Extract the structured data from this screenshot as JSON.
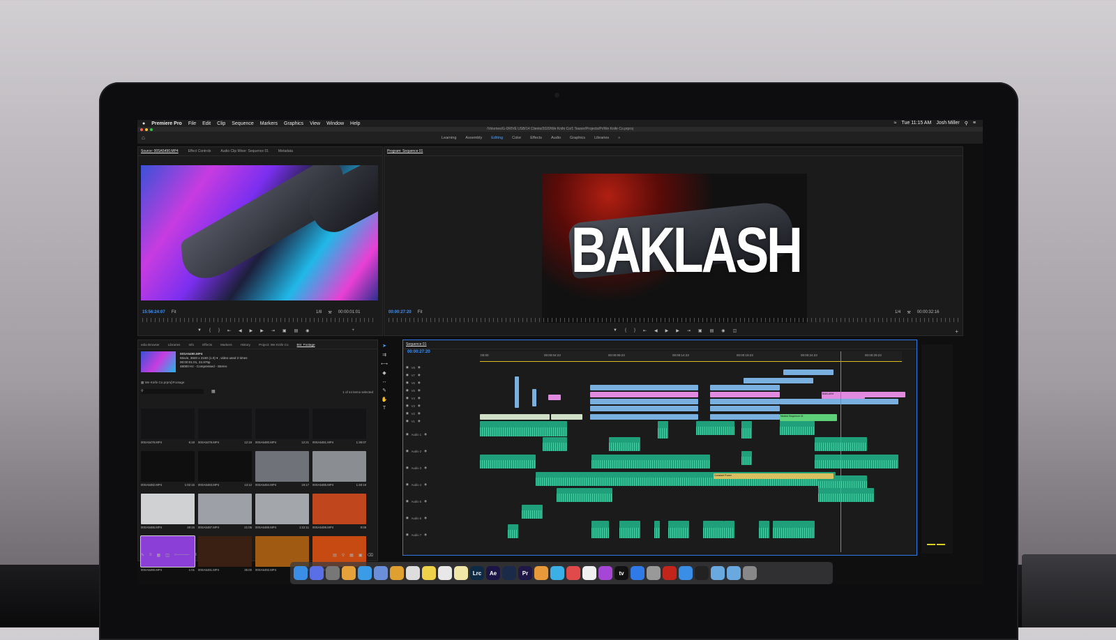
{
  "menubar": {
    "apple": "",
    "app": "Premiere Pro",
    "items": [
      "File",
      "Edit",
      "Clip",
      "Sequence",
      "Markers",
      "Graphics",
      "View",
      "Window",
      "Help"
    ],
    "clock": "Tue 11:15 AM",
    "user": "Josh Miller"
  },
  "titlebar": {
    "path": "/Volumes/G-DRIVE USB/14 Clients/2020/We Knife Co/1 Teaser/Projects/Pr/We Knife Co.prproj"
  },
  "workspaces": [
    "Learning",
    "Assembly",
    "Editing",
    "Color",
    "Effects",
    "Audio",
    "Graphics",
    "Libraries"
  ],
  "active_workspace": "Editing",
  "source": {
    "tabs": [
      "Source: 00SA5490.MP4",
      "Effect Controls",
      "Audio Clip Mixer: Sequence 01",
      "Metadata"
    ],
    "timecode": "15:56:24:07",
    "fit": "Fit",
    "resolution": "1/8",
    "duration": "00:00:01:01"
  },
  "program": {
    "tab": "Program: Sequence 01",
    "title_overlay": "BAKLASH",
    "timecode": "00:00:27:20",
    "fit": "Fit",
    "resolution": "1/4",
    "duration": "00:00:32:16"
  },
  "project": {
    "tabs": [
      "edia Browser",
      "Libraries",
      "Info",
      "Effects",
      "Markers",
      "History",
      "Project: We Knife Co",
      "Bin: Footage"
    ],
    "clip_name": "00SA5490.MP4",
    "clip_info": [
      "Movie, 3840 x 2160 (1.0) ▾ , video used 2 times",
      "00:00:01:01, 23.976p",
      "48000 Hz - Compressed - Stereo"
    ],
    "bin_path": "We Knife Co.prproj\\Footage",
    "selection": "1 of 44 items selected",
    "thumbs": [
      {
        "name": "00SA5478.MP4",
        "dur": "6:18",
        "tone": "#141416"
      },
      {
        "name": "00SA5479.MP4",
        "dur": "12:19",
        "tone": "#141416"
      },
      {
        "name": "00SA5480.MP4",
        "dur": "12:21",
        "tone": "#141416"
      },
      {
        "name": "00SA5481.MP4",
        "dur": "1:39:07",
        "tone": "#141416"
      },
      {
        "name": "00SA5482.MP4",
        "dur": "1:02:16",
        "tone": "#0f0f10"
      },
      {
        "name": "00SA5483.MP4",
        "dur": "13:12",
        "tone": "#0f0f10"
      },
      {
        "name": "00SA5484.MP4",
        "dur": "19:17",
        "tone": "#6f7379"
      },
      {
        "name": "00SA5485.MP4",
        "dur": "1:48:19",
        "tone": "#8a8e93"
      },
      {
        "name": "00SA5486.MP4",
        "dur": "49:15",
        "tone": "#cfd1d3"
      },
      {
        "name": "00SA5487.MP4",
        "dur": "21:05",
        "tone": "#9da0a6"
      },
      {
        "name": "00SA5488.MP4",
        "dur": "1:22:11",
        "tone": "#a3a6ab"
      },
      {
        "name": "00SA5489.MP4",
        "dur": "9:08",
        "tone": "#c0461d"
      },
      {
        "name": "00SA5490.MP4",
        "dur": "1:01",
        "tone": "#8b3fd6"
      },
      {
        "name": "00SA5491.MP4",
        "dur": "35:00",
        "tone": "#3a2012"
      },
      {
        "name": "00SA5492.MP4",
        "dur": "1:17:01",
        "tone": "#a15a12"
      },
      {
        "name": "00SA5493.MP4",
        "dur": "5:09",
        "tone": "#c64a12"
      }
    ]
  },
  "timeline": {
    "tab": "Sequence 01",
    "timecode": "00:00:27:20",
    "ruler": [
      ":00:00",
      "00:00:04:23",
      "00:00:09:23",
      "00:00:14:23",
      "00:00:19:23",
      "00:00:24:23",
      "00:00:29:23"
    ],
    "tracks_video": [
      "V8",
      "V7",
      "V6",
      "V5",
      "V4",
      "V3",
      "V2",
      "V1"
    ],
    "tracks_audio": [
      "Audio 1",
      "Audio 2",
      "Audio 3",
      "Audio 4",
      "Audio 5",
      "Audio 6",
      "Audio 7"
    ],
    "labels": {
      "baklash": "BAKLASH",
      "ncs": "Nested Sequence 01",
      "power": "Constant Power"
    }
  },
  "dock": {
    "apps": [
      {
        "label": "",
        "color": "#3a8ee6"
      },
      {
        "label": "",
        "color": "#5a6ee6"
      },
      {
        "label": "",
        "color": "#777"
      },
      {
        "label": "",
        "color": "#e6a23a"
      },
      {
        "label": "",
        "color": "#3a9be6"
      },
      {
        "label": "",
        "color": "#6b8fd8"
      },
      {
        "label": "",
        "color": "#e0a030"
      },
      {
        "label": "",
        "color": "#ddd"
      },
      {
        "label": "",
        "color": "#f0d24a"
      },
      {
        "label": "",
        "color": "#e8e8e8"
      },
      {
        "label": "",
        "color": "#efe6a8"
      },
      {
        "label": "Lrc",
        "color": "#0d2b45"
      },
      {
        "label": "Ae",
        "color": "#1a1545"
      },
      {
        "label": "",
        "color": "#1c2a4a"
      },
      {
        "label": "Pr",
        "color": "#1f1745"
      },
      {
        "label": "",
        "color": "#e89a3a"
      },
      {
        "label": "",
        "color": "#3ab0e6"
      },
      {
        "label": "",
        "color": "#e14a4a"
      },
      {
        "label": "",
        "color": "#f0f0f0"
      },
      {
        "label": "",
        "color": "#a646d6"
      },
      {
        "label": "tv",
        "color": "#111"
      },
      {
        "label": "",
        "color": "#2f7ae6"
      },
      {
        "label": "",
        "color": "#999"
      },
      {
        "label": "",
        "color": "#c4251b"
      },
      {
        "label": "",
        "color": "#3a8ee6"
      },
      {
        "label": "",
        "color": "#222"
      },
      {
        "label": "",
        "color": "#6aa8e0"
      },
      {
        "label": "",
        "color": "#6aa8e0"
      },
      {
        "label": "",
        "color": "#888"
      }
    ]
  }
}
